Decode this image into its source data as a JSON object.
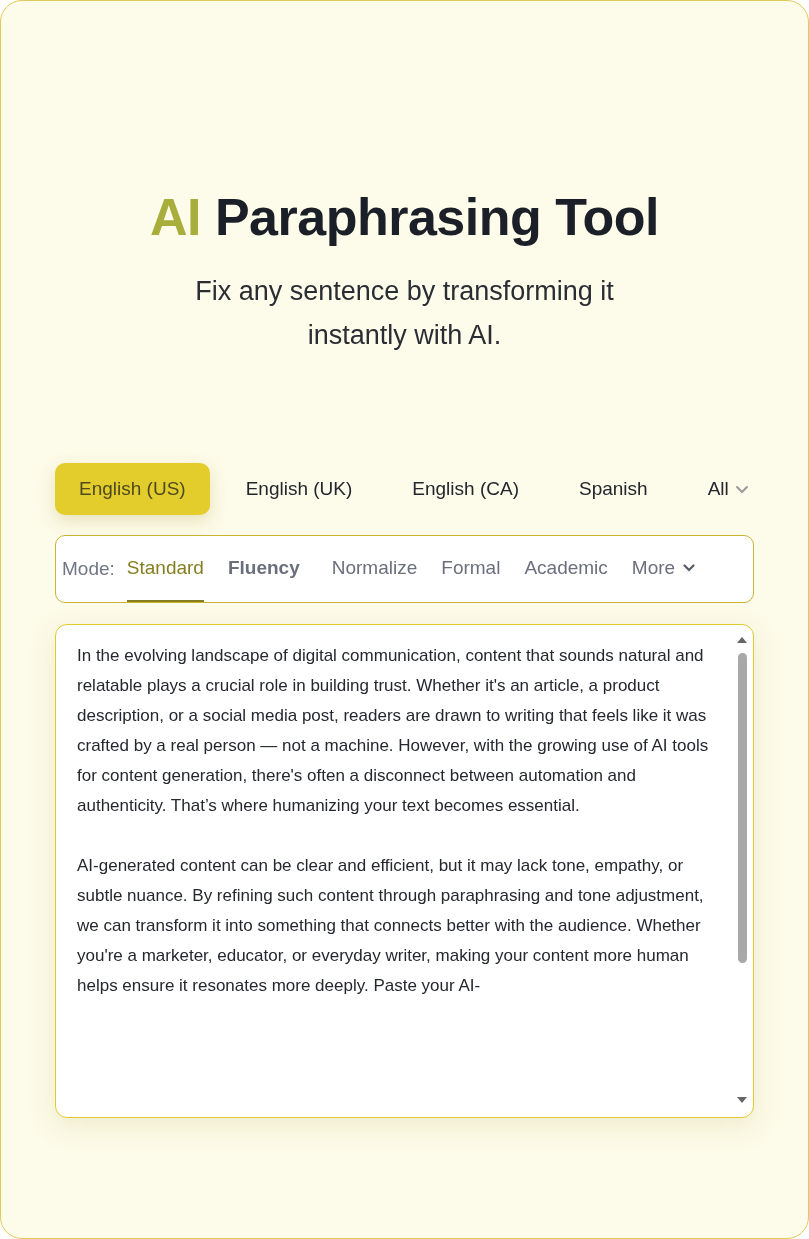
{
  "title": {
    "highlight": "AI",
    "rest": "Paraphrasing Tool"
  },
  "subtitle": "Fix any sentence by transforming it instantly with AI.",
  "languages": [
    {
      "label": "English (US)",
      "selected": true
    },
    {
      "label": "English (UK)",
      "selected": false
    },
    {
      "label": "English (CA)",
      "selected": false
    },
    {
      "label": "Spanish",
      "selected": false
    }
  ],
  "languages_more": "All",
  "mode": {
    "label": "Mode:",
    "items": [
      {
        "label": "Standard",
        "selected": true
      },
      {
        "label": "Fluency",
        "selected": false
      },
      {
        "label": "Normalize",
        "selected": false
      },
      {
        "label": "Formal",
        "selected": false
      },
      {
        "label": "Academic",
        "selected": false
      }
    ],
    "more": "More"
  },
  "editor": {
    "paragraphs": [
      "In the evolving landscape of digital communication, content that sounds natural and relatable plays a crucial role in building trust. Whether it's an article, a product description, or a social media post, readers are drawn to writing that feels like it was crafted by a real person — not a machine. However, with the growing use of AI tools for content generation, there's often a disconnect between automation and authenticity. That’s where humanizing your text becomes essential.",
      "AI-generated content can be clear and efficient, but it may lack tone, empathy, or subtle nuance. By refining such content through paraphrasing and tone adjustment, we can transform it into something that connects better with the audience. Whether you're a marketer, educator, or everyday writer, making your content more human helps ensure it resonates more deeply. Paste your AI-"
    ]
  }
}
